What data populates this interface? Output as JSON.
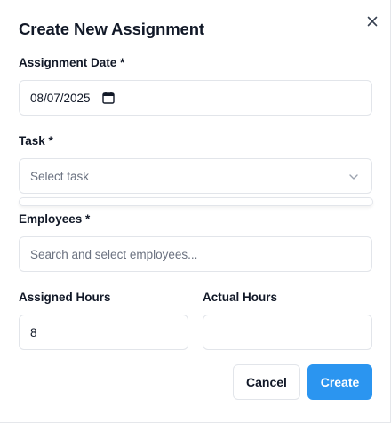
{
  "dialog": {
    "title": "Create New Assignment",
    "close_icon": "close-icon"
  },
  "assignment_date": {
    "label": "Assignment Date *",
    "value": "08/07/2025",
    "icon": "calendar-icon"
  },
  "task": {
    "label": "Task *",
    "placeholder": "Select task",
    "icon": "chevron-down-icon"
  },
  "employees": {
    "label": "Employees *",
    "placeholder": "Search and select employees..."
  },
  "assigned_hours": {
    "label": "Assigned Hours",
    "value": "8"
  },
  "actual_hours": {
    "label": "Actual Hours",
    "value": ""
  },
  "actions": {
    "cancel_label": "Cancel",
    "create_label": "Create"
  },
  "colors": {
    "primary": "#2b95f0",
    "border": "#e2e5ea",
    "text": "#111827",
    "placeholder": "#6b7280"
  }
}
